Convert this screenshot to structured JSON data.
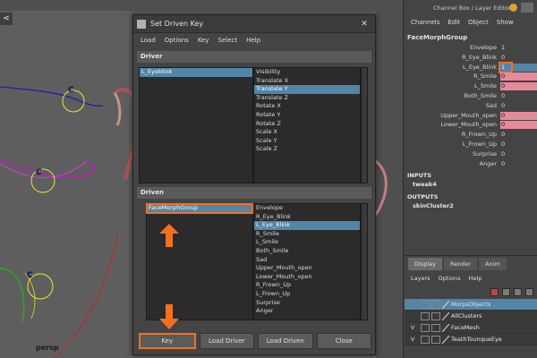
{
  "viewport": {
    "tool_icon": "share-icon",
    "camera_label": "persp",
    "controls": [
      {
        "label": "C"
      },
      {
        "label": "C"
      },
      {
        "label": "C"
      }
    ]
  },
  "dialog": {
    "title": "Set Driven Key",
    "menu": [
      "Load",
      "Options",
      "Key",
      "Select",
      "Help"
    ],
    "driver_header": "Driver",
    "driver_objects": [
      "L_Eyeblink"
    ],
    "driver_attributes": [
      "Visibility",
      "Translate X",
      "Translate Y",
      "Translate Z",
      "Rotate X",
      "Rotate Y",
      "Rotate Z",
      "Scale X",
      "Scale Y",
      "Scale Z"
    ],
    "driver_selected_attribute": "Translate Y",
    "driven_header": "Driven",
    "driven_objects": [
      "FaceMorphGroup"
    ],
    "driven_attributes": [
      "Envelope",
      "R_Eye_Blink",
      "L_Eye_Blink",
      "R_Smile",
      "L_Smile",
      "Both_Smile",
      "Sad",
      "Upper_Mouth_open",
      "Lower_Mouth_open",
      "R_Frown_Up",
      "L_Frown_Up",
      "Surprise",
      "Anger"
    ],
    "driven_selected_attribute": "L_Eye_Blink",
    "buttons": {
      "key": "Key",
      "load_driver": "Load Driver",
      "load_driven": "Load Driven",
      "close": "Close"
    }
  },
  "channel_box": {
    "title": "Channel Box / Layer Editor",
    "menu": [
      "Channels",
      "Edit",
      "Object",
      "Show"
    ],
    "object_name": "FaceMorphGroup",
    "channels": [
      {
        "label": "Envelope",
        "value": "1"
      },
      {
        "label": "R_Eye_Blink",
        "value": "0"
      },
      {
        "label": "L_Eye_Blink",
        "value": "1"
      },
      {
        "label": "R_Smile",
        "value": "0"
      },
      {
        "label": "L_Smile",
        "value": "0"
      },
      {
        "label": "Both_Smile",
        "value": "0"
      },
      {
        "label": "Sad",
        "value": "0"
      },
      {
        "label": "Upper_Mouth_open",
        "value": "0"
      },
      {
        "label": "Lower_Mouth_open",
        "value": "0"
      },
      {
        "label": "R_Frown_Up",
        "value": "0"
      },
      {
        "label": "L_Frown_Up",
        "value": "0"
      },
      {
        "label": "Surprise",
        "value": "0"
      },
      {
        "label": "Anger",
        "value": "0"
      }
    ],
    "inputs_header": "INPUTS",
    "inputs": [
      "tweak4"
    ],
    "outputs_header": "OUTPUTS",
    "outputs": [
      "skinCluster2"
    ]
  },
  "layer_editor": {
    "tabs": [
      "Display",
      "Render",
      "Anim"
    ],
    "menu": [
      "Layers",
      "Options",
      "Help"
    ],
    "layers": [
      {
        "visible": "",
        "name": "MorpsObjects"
      },
      {
        "visible": "",
        "name": "AllClusters"
      },
      {
        "visible": "V",
        "name": "FaceMesh"
      },
      {
        "visible": "V",
        "name": "TeathTounqueEye"
      }
    ]
  },
  "colors": {
    "accent_orange": "#f37021",
    "selection_blue": "#5285a6",
    "driven_pink": "#e58a9a"
  }
}
